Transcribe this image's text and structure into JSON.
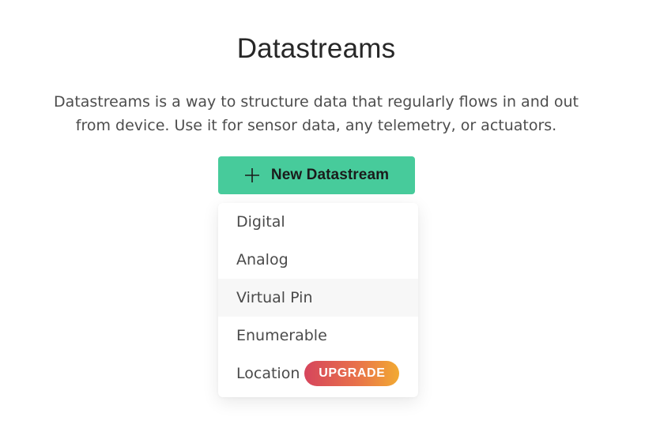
{
  "header": {
    "title": "Datastreams"
  },
  "intro": {
    "line1": "Datastreams is a way to structure data that regularly flows in and out",
    "line2": "from device. Use it for sensor data, any telemetry, or actuators."
  },
  "new_button": {
    "icon": "plus-icon",
    "label": "New Datastream",
    "color": "#47cb9b"
  },
  "dropdown": {
    "items": [
      {
        "label": "Digital"
      },
      {
        "label": "Analog"
      },
      {
        "label": "Virtual Pin"
      },
      {
        "label": "Enumerable"
      },
      {
        "label": "Location",
        "badge": "UPGRADE"
      }
    ],
    "hovered_item": "Virtual Pin",
    "badge_colors": [
      "#d6455c",
      "#f2aa32"
    ]
  }
}
